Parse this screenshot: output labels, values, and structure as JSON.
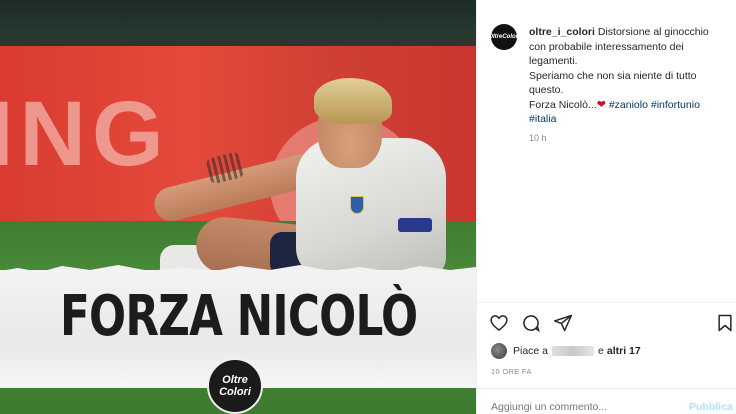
{
  "post": {
    "image": {
      "headline": "FORZA NICOLÒ",
      "board_text": "ING",
      "logo_line1": "Oltre",
      "logo_line2": "Colori"
    },
    "author": {
      "username": "oltre_i_colori",
      "avatar_line1": "Oltre",
      "avatar_line2": "Colori"
    },
    "caption": {
      "line1": "Distorsione al ginocchio",
      "line2": "con probabile interessamento dei",
      "line3": "legamenti.",
      "line4": "Speriamo che non sia niente di tutto",
      "line5": "questo.",
      "line6_text": "Forza Nicolò...",
      "heart": "❤",
      "tag1": "#zaniolo",
      "tag2": "#infortunio",
      "tag3": "#italia"
    },
    "time_ago": "10 h",
    "likes": {
      "prefix": "Piace a",
      "suffix": "e",
      "others": "altri 17"
    },
    "date": "10 ORE FA",
    "comment": {
      "placeholder": "Aggiungi un commento...",
      "publish_label": "Pubblica"
    },
    "icons": [
      "heart-icon",
      "comment-icon",
      "share-icon",
      "bookmark-icon"
    ]
  }
}
